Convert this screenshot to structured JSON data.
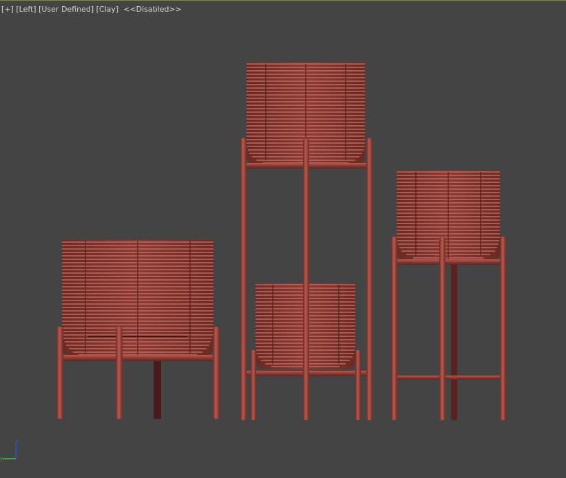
{
  "viewport": {
    "menu_plus": "[+]",
    "view_name": "[Left]",
    "camera_mode": "[User Defined]",
    "shading_mode": "[Clay]",
    "status": "<<Disabled>>"
  },
  "axis_gizmo": {
    "z_label": "z",
    "y_label": "y",
    "z_color": "#2f4fd8",
    "y_color": "#3fbf3f"
  },
  "scene": {
    "object_color": "#8e3a33",
    "object_highlight": "#b85a4f",
    "background_color": "#444444",
    "objects": [
      "short-wide-planter",
      "tall-double-stand",
      "medium-planter-stand"
    ]
  }
}
